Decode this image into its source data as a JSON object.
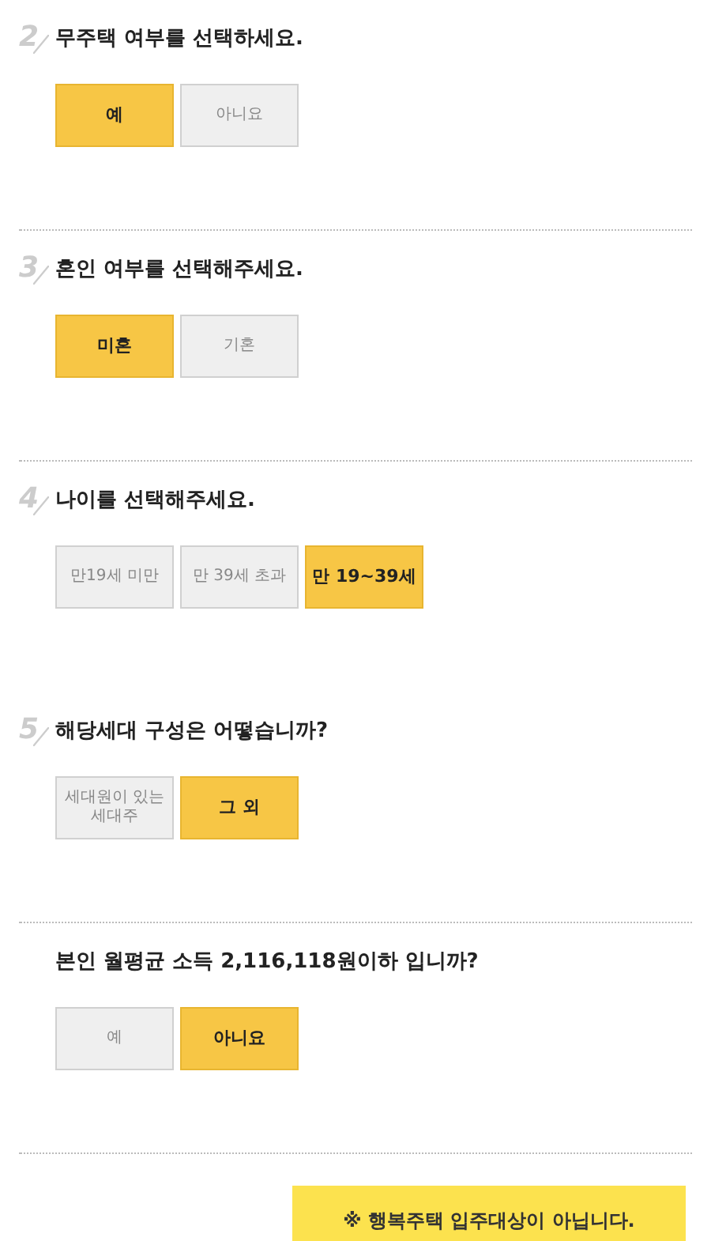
{
  "questions": [
    {
      "number": "2",
      "title": "무주택 여부를 선택하세요.",
      "divider": true,
      "options": [
        {
          "label": "예",
          "selected": true
        },
        {
          "label": "아니요",
          "selected": false
        }
      ]
    },
    {
      "number": "3",
      "title": "혼인 여부를 선택해주세요.",
      "divider": true,
      "options": [
        {
          "label": "미혼",
          "selected": true
        },
        {
          "label": "기혼",
          "selected": false
        }
      ]
    },
    {
      "number": "4",
      "title": "나이를 선택해주세요.",
      "divider": false,
      "options": [
        {
          "label": "만19세 미만",
          "selected": false
        },
        {
          "label": "만 39세 초과",
          "selected": false
        },
        {
          "label": "만 19~39세",
          "selected": true
        }
      ]
    },
    {
      "number": "5",
      "title": "해당세대 구성은 어떻습니까?",
      "divider": true,
      "options": [
        {
          "label": "세대원이 있는 세대주",
          "selected": false
        },
        {
          "label": "그 외",
          "selected": true
        }
      ]
    },
    {
      "title": "본인 월평균 소득 2,116,118원이하 입니까?",
      "divider": true,
      "options": [
        {
          "label": "예",
          "selected": false
        },
        {
          "label": "아니요",
          "selected": true
        }
      ]
    }
  ],
  "result": {
    "message": "※ 행복주택 입주대상이 아닙니다."
  }
}
